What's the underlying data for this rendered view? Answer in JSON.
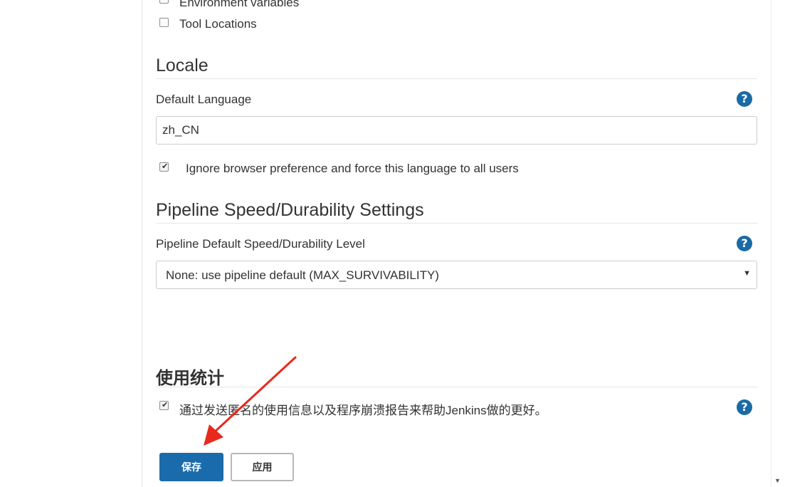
{
  "top_options": [
    {
      "label": "Environment variables",
      "checked": false
    },
    {
      "label": "Tool Locations",
      "checked": false
    }
  ],
  "locale": {
    "title": "Locale",
    "default_language_label": "Default Language",
    "default_language_value": "zh_CN",
    "ignore_browser_label": "Ignore browser preference and force this language to all users",
    "ignore_browser_checked": true
  },
  "pipeline": {
    "title": "Pipeline Speed/Durability Settings",
    "level_label": "Pipeline Default Speed/Durability Level",
    "level_value": "None: use pipeline default (MAX_SURVIVABILITY)"
  },
  "usage": {
    "title": "使用统计",
    "send_stats_label": "通过发送匿名的使用信息以及程序崩溃报告来帮助Jenkins做的更好。",
    "send_stats_checked": true
  },
  "buttons": {
    "save_label": "保存",
    "apply_label": "应用"
  },
  "icons": {
    "help": "help-icon",
    "check": "check-mark-icon",
    "dropdown": "chevron-down-icon"
  },
  "colors": {
    "primary": "#1a6bab",
    "help": "#1b6aa6",
    "annotation_arrow": "#e8291c"
  }
}
